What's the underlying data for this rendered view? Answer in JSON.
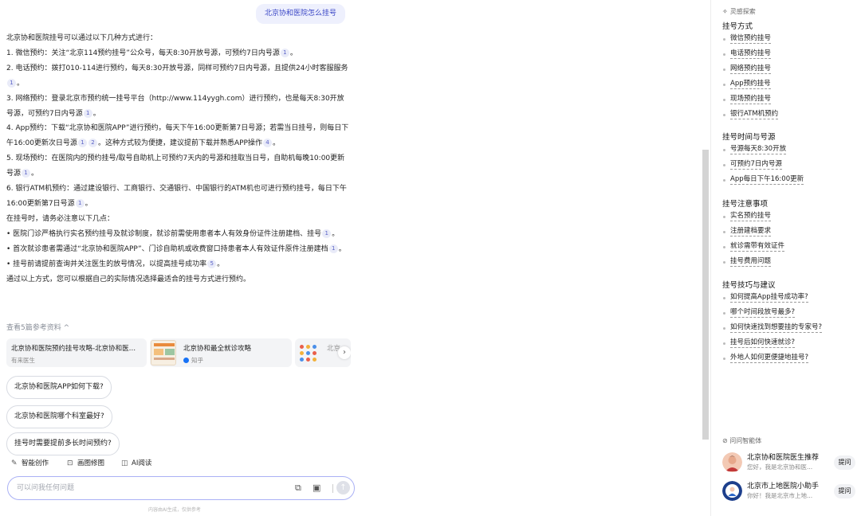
{
  "chat": {
    "user_question": "北京协和医院怎么挂号",
    "answer": [
      {
        "text": "北京协和医院挂号可以通过以下几种方式进行：",
        "cites": []
      },
      {
        "text": "1. 微信预约：关注“北京114预约挂号”公众号，每天8:30开放号源，可预约7日内号源",
        "cites": [
          "1"
        ],
        "tail": "。"
      },
      {
        "text": "2. 电话预约：拨打010-114进行预约，每天8:30开放号源，同样可预约7日内号源，且提供24小时客服服务",
        "cites": [
          "1"
        ],
        "tail": "。"
      },
      {
        "text": "3. 网络预约：登录北京市预约统一挂号平台（http://www.114yygh.com）进行预约，也是每天8:30开放号源，可预约7日内号源",
        "cites": [
          "1"
        ],
        "tail": "。"
      },
      {
        "text": "4. App预约：下载“北京协和医院APP”进行预约，每天下午16:00更新第7日号源；若需当日挂号，则每日下午16:00更新次日号源",
        "cites": [
          "1",
          "2"
        ],
        "tail": "。这种方式较为便捷，建议提前下载并熟悉APP操作",
        "cites2": [
          "4"
        ],
        "tail2": "。"
      },
      {
        "text": "5. 现场预约：在医院内的预约挂号/取号自助机上可预约7天内的号源和挂取当日号，自助机每晚10:00更新号源",
        "cites": [
          "1"
        ],
        "tail": "。"
      },
      {
        "text": "6. 银行ATM机预约：通过建设银行、工商银行、交通银行、中国银行的ATM机也可进行预约挂号，每日下午16:00更新第7日号源",
        "cites": [
          "1"
        ],
        "tail": "。"
      },
      {
        "text": "在挂号时，请务必注意以下几点：",
        "cites": []
      },
      {
        "text": "• 医院门诊严格执行实名预约挂号及就诊制度，就诊前需使用患者本人有效身份证件注册建档、挂号",
        "cites": [
          "1"
        ],
        "tail": "。"
      },
      {
        "text": "• 首次就诊患者需通过“北京协和医院APP”、门诊自助机或收费窗口持患者本人有效证件原件注册建档",
        "cites": [
          "1"
        ],
        "tail": "。"
      },
      {
        "text": "• 挂号前请提前查询并关注医生的放号情况，以提高挂号成功率",
        "cites": [
          "5"
        ],
        "tail": "。"
      },
      {
        "text": "通过以上方式，您可以根据自己的实际情况选择最适合的挂号方式进行预约。",
        "cites": []
      }
    ],
    "refs_toggle": "查看5篇参考资料 ^",
    "refs": [
      {
        "title": "北京协和医院预约挂号攻略-北京协和医院...",
        "source": "有来医生"
      },
      {
        "title": "北京协和最全就诊攻略",
        "source": "知乎"
      },
      {
        "title": "北京",
        "source": ""
      }
    ],
    "suggestions": [
      "北京协和医院APP如何下载?",
      "北京协和医院哪个科室最好?",
      "挂号时需要提前多长时间预约?"
    ],
    "tools": [
      {
        "icon": "pen-icon",
        "glyph": "✎",
        "label": "智能创作"
      },
      {
        "icon": "image-icon",
        "glyph": "⊡",
        "label": "画图修图"
      },
      {
        "icon": "read-icon",
        "glyph": "◫",
        "label": "AI阅读"
      }
    ],
    "input_placeholder": "可以问我任何问题",
    "disclaimer": "内容由AI生成，仅供参考"
  },
  "sidebar": {
    "header": "灵感探索",
    "sections": [
      {
        "title": "挂号方式",
        "items": [
          "微信预约挂号",
          "电话预约挂号",
          "网络预约挂号",
          "App预约挂号",
          "现场预约挂号",
          "银行ATM机预约"
        ]
      },
      {
        "title": "挂号时间与号源",
        "items": [
          "号源每天8:30开放",
          "可预约7日内号源",
          "App每日下午16:00更新"
        ]
      },
      {
        "title": "挂号注意事项",
        "items": [
          "实名预约挂号",
          "注册建档要求",
          "就诊需带有效证件",
          "挂号费用问题"
        ]
      },
      {
        "title": "挂号技巧与建议",
        "items": [
          "如何提高App挂号成功率?",
          "哪个时间段放号最多?",
          "如何快速找到想要挂的专家号?",
          "挂号后如何快速就诊?",
          "外地人如何更便捷地挂号?"
        ]
      }
    ],
    "agents_header": "问问智能体",
    "agents": [
      {
        "name": "北京协和医院医生推荐",
        "desc": "您好，我是北京协和医...",
        "button": "提问"
      },
      {
        "name": "北京市上地医院小助手",
        "desc": "你好！我是北京市上地...",
        "button": "提问"
      }
    ]
  },
  "colors": {
    "accent": "#3a46c6",
    "bubble": "#eef0fd",
    "input_border": "#aab1f5"
  }
}
